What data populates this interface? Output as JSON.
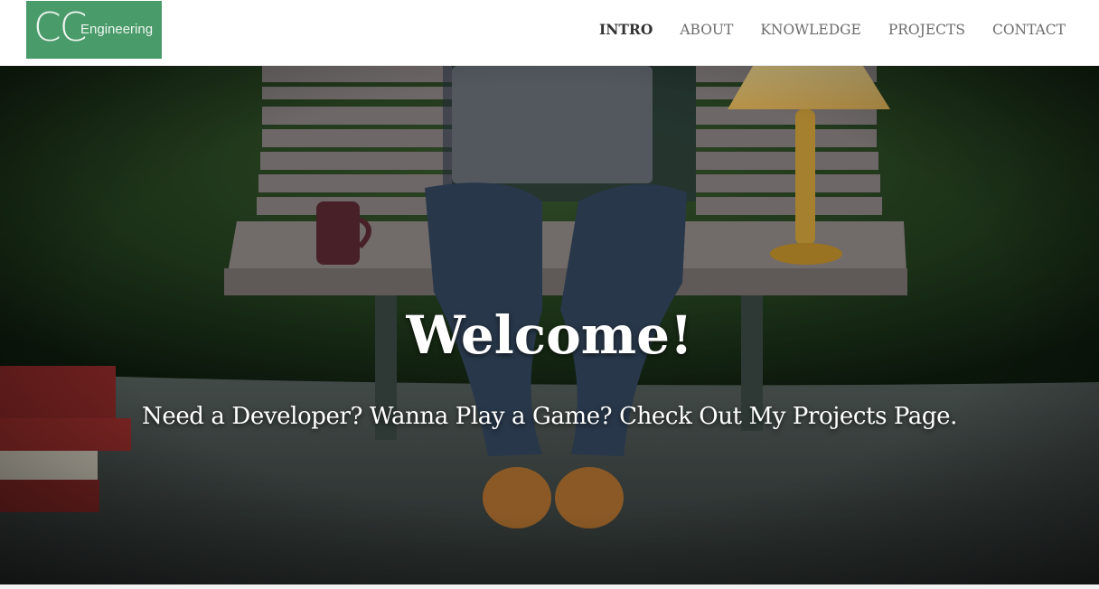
{
  "logo": {
    "monogram": "CC",
    "wordmark": "Engineering",
    "color": "#4a9b6a"
  },
  "nav": {
    "items": [
      {
        "label": "INTRO",
        "active": true
      },
      {
        "label": "ABOUT",
        "active": false
      },
      {
        "label": "KNOWLEDGE",
        "active": false
      },
      {
        "label": "PROJECTS",
        "active": false
      },
      {
        "label": "CONTACT",
        "active": false
      }
    ]
  },
  "hero": {
    "title": "Welcome!",
    "subtitle": "Need a Developer? Wanna Play a Game? Check Out My Projects Page.",
    "background_icon": "hero-photo-bench-laptop"
  },
  "colors": {
    "accent": "#4a9b6a",
    "nav_text": "#6b6b6b",
    "nav_active": "#333333",
    "hero_text": "#ffffff"
  }
}
